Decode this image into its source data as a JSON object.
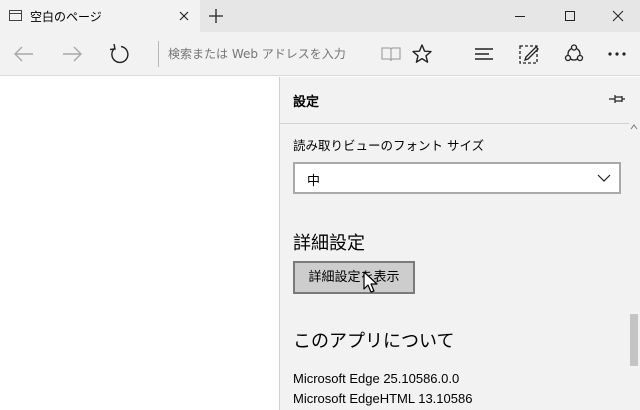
{
  "tab": {
    "title": "空白のページ",
    "page_icon": "page-icon",
    "close_icon": "close-icon"
  },
  "titlebar": {
    "new_tab_icon": "plus-icon",
    "minimize_icon": "minimize-icon",
    "maximize_icon": "maximize-icon",
    "close_icon": "close-icon"
  },
  "toolbar": {
    "back_icon": "arrow-left-icon",
    "forward_icon": "arrow-right-icon",
    "refresh_icon": "refresh-icon",
    "address_placeholder": "検索または Web アドレスを入力",
    "reading_view_icon": "book-icon",
    "favorite_icon": "star-icon",
    "hub_icon": "hub-lines-icon",
    "webnote_icon": "pen-square-icon",
    "share_icon": "share-icon",
    "more_icon": "ellipsis-icon"
  },
  "settings": {
    "title": "設定",
    "pin_icon": "pin-icon",
    "reading_font_label": "読み取りビューのフォント サイズ",
    "reading_font_value": "中",
    "advanced_heading": "詳細設定",
    "advanced_button": "詳細設定を表示",
    "about_heading": "このアプリについて",
    "version_lines": [
      "Microsoft Edge 25.10586.0.0",
      "Microsoft EdgeHTML 13.10586"
    ]
  },
  "colors": {
    "chrome_bg": "#f2f2f2",
    "titlebar_bg": "#e6e6e6",
    "button_bg": "#cdcdcd",
    "button_border": "#7a7a7a",
    "placeholder": "#8a8a8a"
  }
}
